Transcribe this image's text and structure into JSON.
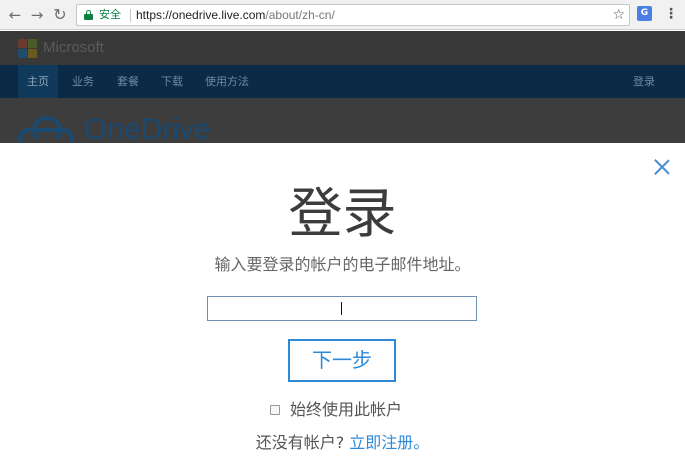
{
  "browser": {
    "secure_label": "安全",
    "url_main": "https://onedrive.live.com",
    "url_path": "/about/zh-cn/",
    "back_icon": "arrow-left-icon",
    "forward_icon": "arrow-right-icon",
    "reload_icon": "reload-icon",
    "bookmark_icon": "star-icon",
    "extension_icon": "translate-icon",
    "menu_icon": "more-vert-icon",
    "secure_color": "#0b8043"
  },
  "background_page": {
    "brand": "Microsoft",
    "nav_items": [
      "主页",
      "业务",
      "套餐",
      "下载",
      "使用方法"
    ],
    "sign_in": "登录",
    "product": "OneDrive"
  },
  "modal": {
    "title": "登录",
    "subtitle": "输入要登录的帐户的电子邮件地址。",
    "email_value": "",
    "next_label": "下一步",
    "remember_label": "始终使用此帐户",
    "remember_checked": false,
    "no_account_text": "还没有帐户?",
    "signup_link": "立即注册。",
    "accent_color": "#2f8ad6"
  }
}
